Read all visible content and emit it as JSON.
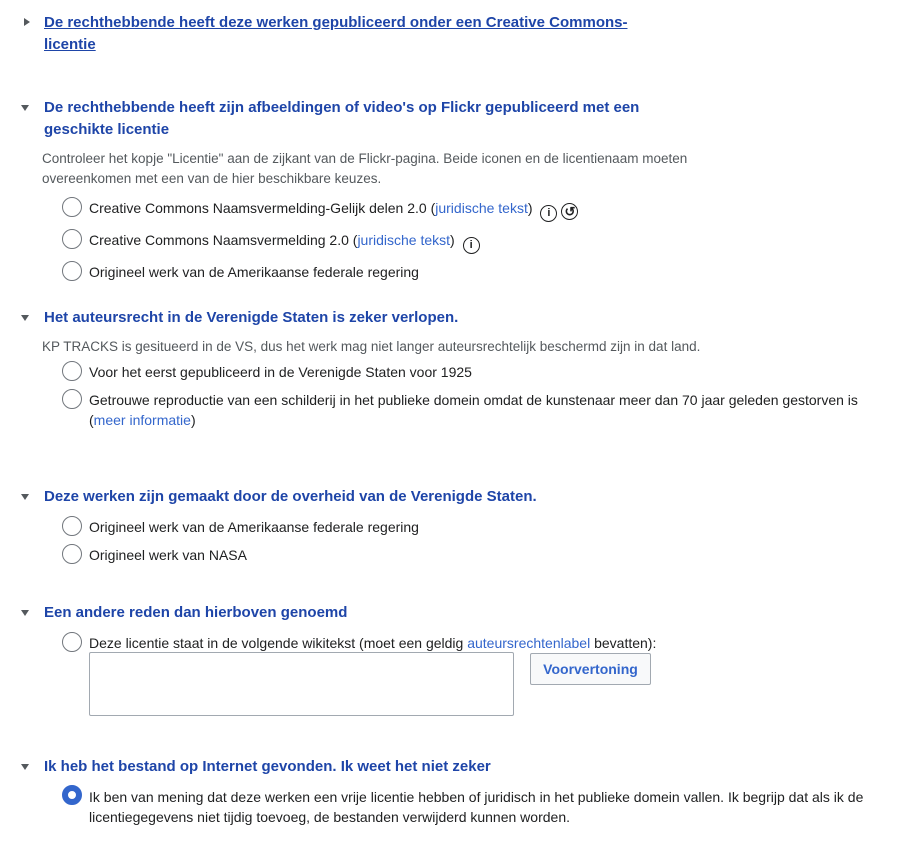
{
  "sections": {
    "cc": {
      "title": "De rechthebbende heeft deze werken gepubliceerd onder een Creative Commons-licentie"
    },
    "flickr": {
      "title": "De rechthebbende heeft zijn afbeeldingen of video's op Flickr gepubliceerd met een geschikte licentie",
      "description": "Controleer het kopje \"Licentie\" aan de zijkant van de Flickr-pagina. Beide iconen en de licentienaam moeten overeenkomen met een van de hier beschikbare keuzes.",
      "options": [
        {
          "label": "Creative Commons Naamsvermelding-Gelijk delen 2.0 (",
          "link": "juridische tekst",
          "suffix": ")",
          "icons": [
            "cc-by-icon",
            "cc-sa-icon"
          ]
        },
        {
          "label": "Creative Commons Naamsvermelding 2.0 (",
          "link": "juridische tekst",
          "suffix": ")",
          "icons": [
            "cc-by-icon"
          ]
        },
        {
          "label": "Origineel werk van de Amerikaanse federale regering"
        }
      ]
    },
    "expired": {
      "title": "Het auteursrecht in de Verenigde Staten is zeker verlopen.",
      "description": "KP TRACKS is gesitueerd in de VS, dus het werk mag niet langer auteursrechtelijk beschermd zijn in dat land.",
      "options": [
        {
          "label": "Voor het eerst gepubliceerd in de Verenigde Staten voor 1925"
        },
        {
          "label": "Getrouwe reproductie van een schilderij in het publieke domein omdat de kunstenaar meer dan 70 jaar geleden gestorven is (",
          "link": "meer informatie",
          "suffix": ")"
        }
      ]
    },
    "usgov": {
      "title": "Deze werken zijn gemaakt door de overheid van de Verenigde Staten.",
      "options": [
        {
          "label": "Origineel werk van de Amerikaanse federale regering"
        },
        {
          "label": "Origineel werk van NASA"
        }
      ]
    },
    "other": {
      "title": "Een andere reden dan hierboven genoemd",
      "option": {
        "label": "Deze licentie staat in de volgende wikitekst (moet een geldig ",
        "link": "auteursrechtenlabel",
        "suffix": " bevatten):"
      },
      "textarea_value": "",
      "preview_button": "Voorvertoning"
    },
    "internet": {
      "title": "Ik heb het bestand op Internet gevonden. Ik weet het niet zeker",
      "option": {
        "label": "Ik ben van mening dat deze werken een vrije licentie hebben of juridisch in het publieke domein vallen. Ik begrijp dat als ik de licentiegegevens niet tijdig toevoeg, de bestanden verwijderd kunnen worden.",
        "checked": true
      }
    }
  },
  "colors": {
    "accent": "#3366cc",
    "heading": "#1e45a8",
    "muted": "#54595d",
    "text": "#202122"
  },
  "icon_glyphs": {
    "cc-by-icon": "i",
    "cc-sa-icon": "↺"
  }
}
